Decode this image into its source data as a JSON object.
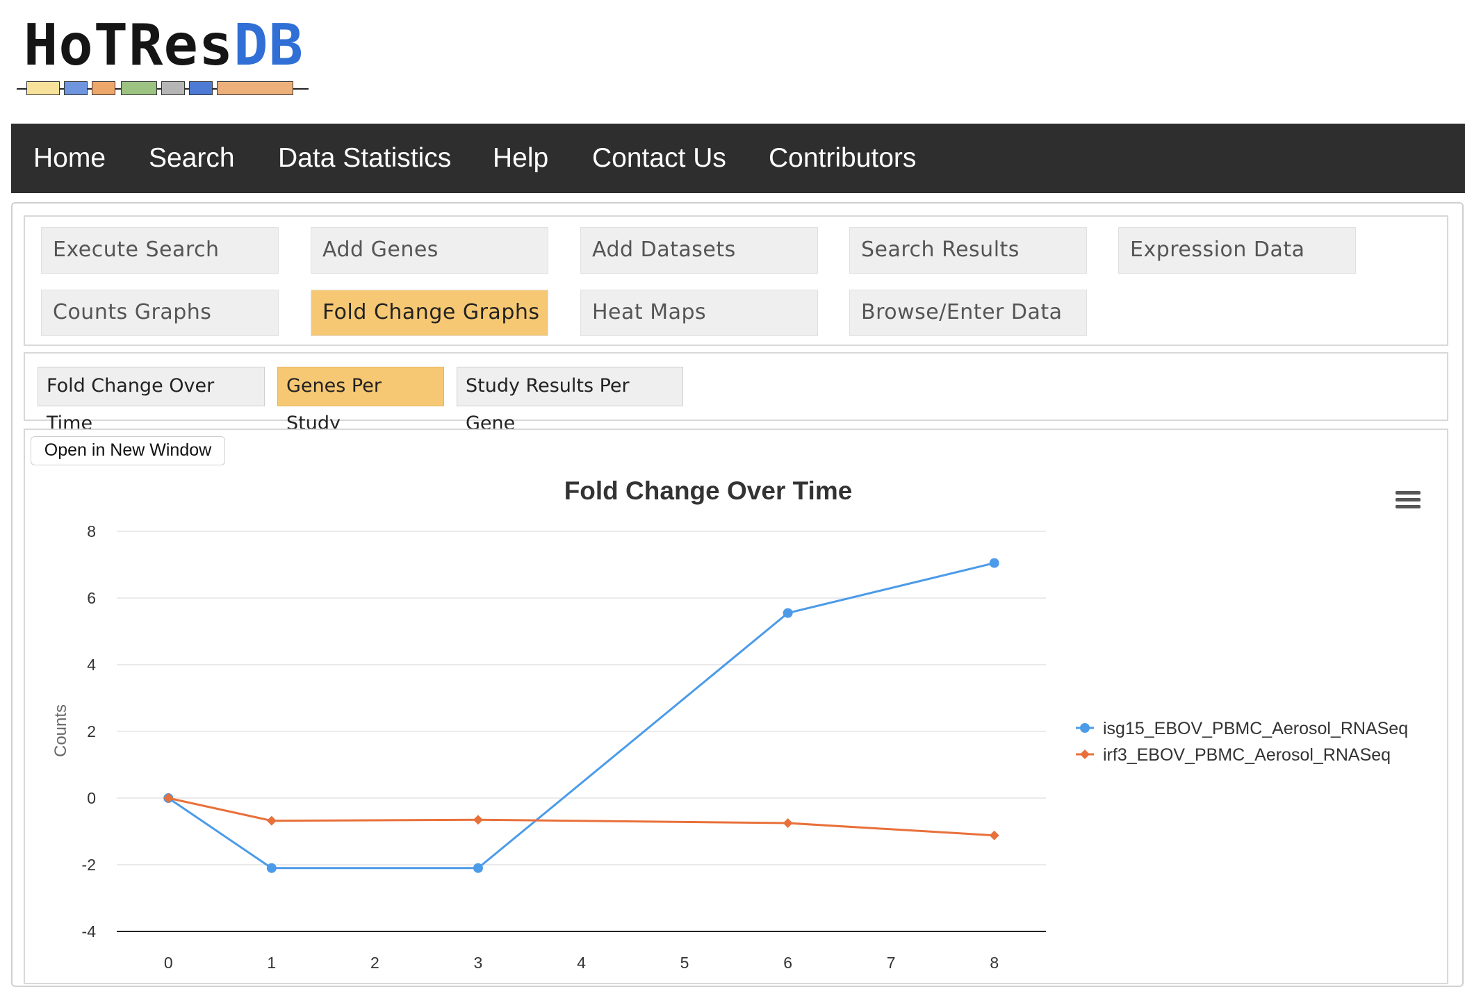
{
  "logo": {
    "text_part1": "HoTRes",
    "text_part2": "DB",
    "segment_colors": [
      "#f8e19a",
      "#6e95de",
      "#eea76a",
      "#9dc383",
      "#b5b5b5",
      "#4d7ad5",
      "#eeb07b"
    ]
  },
  "nav": {
    "items": [
      "Home",
      "Search",
      "Data Statistics",
      "Help",
      "Contact Us",
      "Contributors"
    ]
  },
  "tabs": {
    "row1": [
      "Execute Search",
      "Add Genes",
      "Add Datasets",
      "Search Results",
      "Expression Data"
    ],
    "row2": [
      "Counts Graphs",
      "Fold Change Graphs",
      "Heat Maps",
      "Browse/Enter Data"
    ],
    "active": "Fold Change Graphs"
  },
  "subtabs": {
    "items": [
      "Fold Change Over Time",
      "Genes Per Study",
      "Study Results Per Gene"
    ],
    "active": "Genes Per Study"
  },
  "open_window_label": "Open in New Window",
  "colors": {
    "active_tab": "#f7c873",
    "nav_bg": "#2e2e2e",
    "series1": "#4c9be8",
    "series2": "#e8703a"
  },
  "chart_data": {
    "type": "line",
    "title": "Fold Change Over Time",
    "ylabel": "Counts",
    "xlabel": "",
    "x_ticks": [
      0,
      1,
      2,
      3,
      4,
      5,
      6,
      7,
      8
    ],
    "y_ticks": [
      -4,
      -2,
      0,
      2,
      4,
      6,
      8
    ],
    "xlim": [
      -0.5,
      8.5
    ],
    "ylim": [
      -4,
      8
    ],
    "grid": true,
    "legend_position": "right",
    "series": [
      {
        "name": "isg15_EBOV_PBMC_Aerosol_RNASeq",
        "color": "#4c9be8",
        "marker": "circle",
        "x": [
          0,
          1,
          3,
          6,
          8
        ],
        "y": [
          0,
          -2.1,
          -2.1,
          5.55,
          7.05
        ]
      },
      {
        "name": "irf3_EBOV_PBMC_Aerosol_RNASeq",
        "color": "#e8703a",
        "marker": "diamond",
        "x": [
          0,
          1,
          3,
          6,
          8
        ],
        "y": [
          0,
          -0.68,
          -0.65,
          -0.75,
          -1.12
        ]
      }
    ]
  }
}
